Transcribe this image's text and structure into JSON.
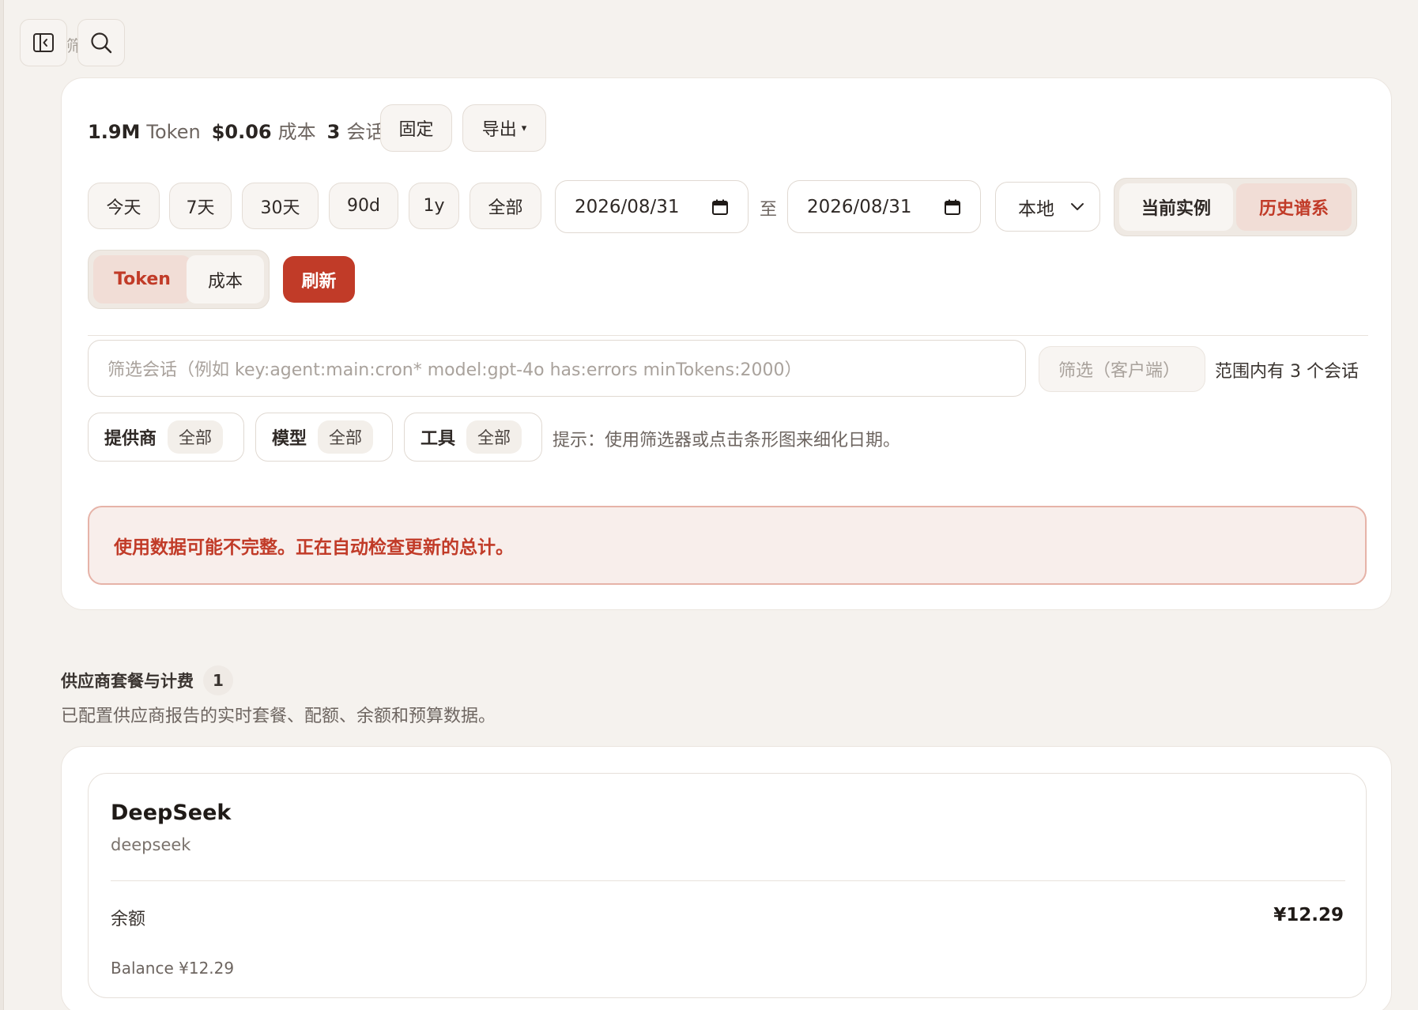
{
  "header": {
    "ghost_text": "筛选"
  },
  "summary": {
    "tokens_value": "1.9M",
    "tokens_label": "Token",
    "cost_value": "$0.06",
    "cost_label": "成本",
    "sessions_value": "3",
    "sessions_label": "会话",
    "pin_label": "固定",
    "export_label": "导出",
    "export_caret": "▾"
  },
  "ranges": [
    "今天",
    "7天",
    "30天",
    "90d",
    "1y",
    "全部"
  ],
  "dates": {
    "start": "2026/08/31",
    "separator": "至",
    "end": "2026/08/31"
  },
  "timezone": {
    "selected": "本地"
  },
  "scope_toggle": {
    "current": "当前实例",
    "history": "历史谱系"
  },
  "metric_toggle": {
    "token": "Token",
    "cost": "成本"
  },
  "refresh_label": "刷新",
  "filters": {
    "query_placeholder": "筛选会话（例如 key:agent:main:cron* model:gpt-4o has:errors minTokens:2000）",
    "client_placeholder": "筛选（客户端）",
    "range_count": "范围内有 3 个会话",
    "chips": [
      {
        "label": "提供商",
        "value": "全部"
      },
      {
        "label": "模型",
        "value": "全部"
      },
      {
        "label": "工具",
        "value": "全部"
      }
    ],
    "hint": "提示：使用筛选器或点击条形图来细化日期。"
  },
  "alert": {
    "text": "使用数据可能不完整。正在自动检查更新的总计。"
  },
  "plans_section": {
    "title": "供应商套餐与计费",
    "count": "1",
    "description": "已配置供应商报告的实时套餐、配额、余额和预算数据。"
  },
  "provider": {
    "name": "DeepSeek",
    "id": "deepseek",
    "balance_label": "余额",
    "balance_value": "¥12.29",
    "balance_note": "Balance ¥12.29"
  },
  "colors": {
    "accent": "#c13b28",
    "background": "#f5f2ee"
  }
}
